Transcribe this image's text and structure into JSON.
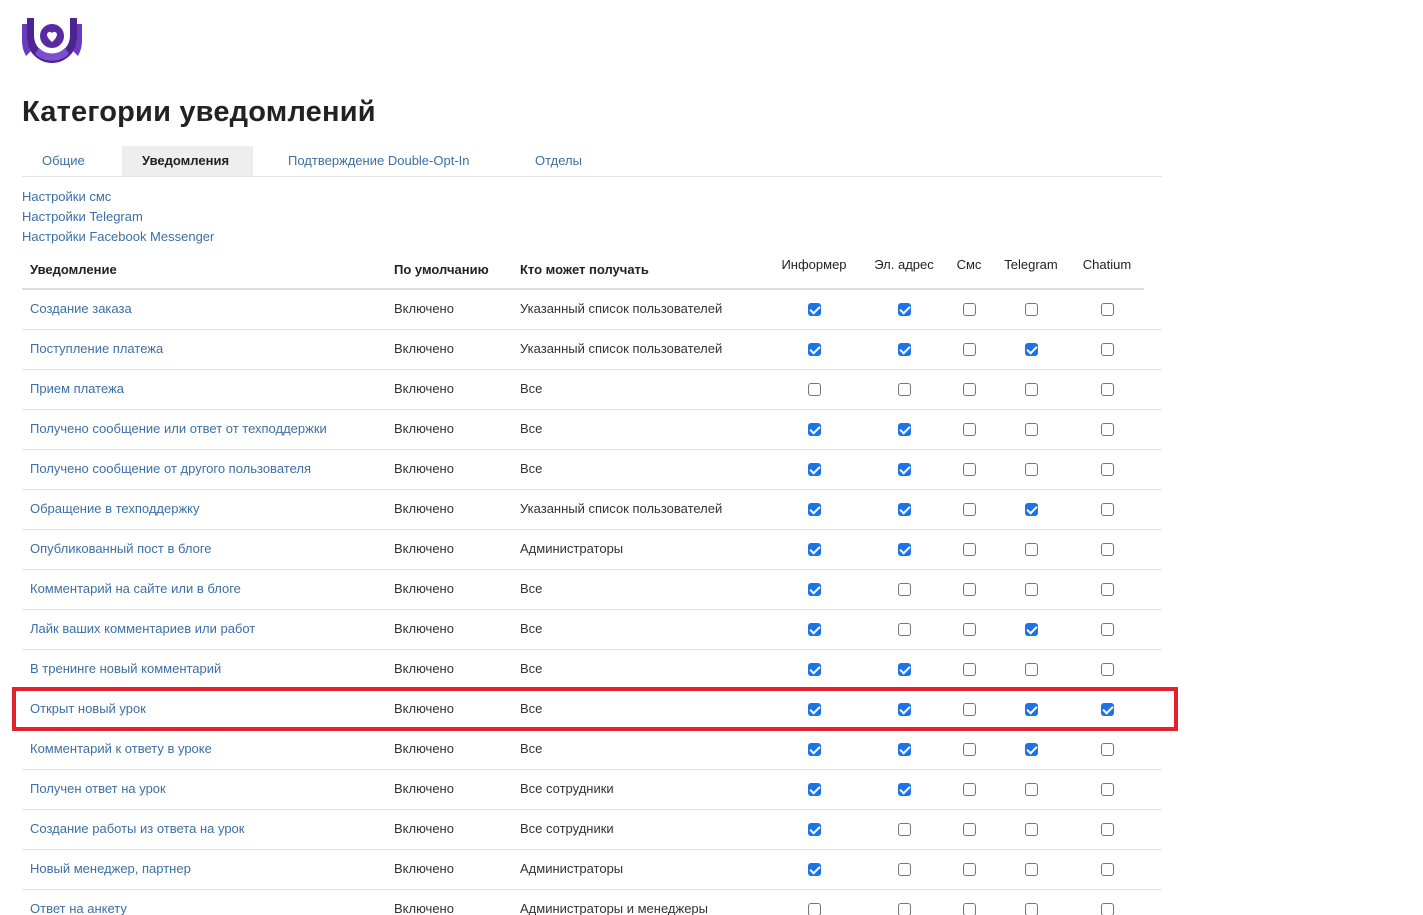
{
  "page": {
    "title": "Категории уведомлений"
  },
  "tabs": [
    {
      "label": "Общие",
      "active": false
    },
    {
      "label": "Уведомления",
      "active": true
    },
    {
      "label": "Подтверждение Double-Opt-In",
      "active": false
    },
    {
      "label": "Отделы",
      "active": false
    }
  ],
  "links": [
    "Настройки смс",
    "Настройки Telegram",
    "Настройки Facebook Messenger"
  ],
  "table": {
    "headers": {
      "notification": "Уведомление",
      "default": "По умолчанию",
      "who": "Кто может получать"
    },
    "channels": [
      "Информер",
      "Эл. адрес",
      "Смс",
      "Telegram",
      "Chatium"
    ],
    "rows": [
      {
        "name": "Создание заказа",
        "default": "Включено",
        "who": "Указанный список пользователей",
        "checks": [
          true,
          true,
          false,
          false,
          false
        ]
      },
      {
        "name": "Поступление платежа",
        "default": "Включено",
        "who": "Указанный список пользователей",
        "checks": [
          true,
          true,
          false,
          true,
          false
        ]
      },
      {
        "name": "Прием платежа",
        "default": "Включено",
        "who": "Все",
        "checks": [
          false,
          false,
          false,
          false,
          false
        ]
      },
      {
        "name": "Получено сообщение или ответ от техподдержки",
        "default": "Включено",
        "who": "Все",
        "checks": [
          true,
          true,
          false,
          false,
          false
        ]
      },
      {
        "name": "Получено сообщение от другого пользователя",
        "default": "Включено",
        "who": "Все",
        "checks": [
          true,
          true,
          false,
          false,
          false
        ]
      },
      {
        "name": "Обращение в техподдержку",
        "default": "Включено",
        "who": "Указанный список пользователей",
        "checks": [
          true,
          true,
          false,
          true,
          false
        ]
      },
      {
        "name": "Опубликованный пост в блоге",
        "default": "Включено",
        "who": "Администраторы",
        "checks": [
          true,
          true,
          false,
          false,
          false
        ]
      },
      {
        "name": "Комментарий на сайте или в блоге",
        "default": "Включено",
        "who": "Все",
        "checks": [
          true,
          false,
          false,
          false,
          false
        ]
      },
      {
        "name": "Лайк ваших комментариев или работ",
        "default": "Включено",
        "who": "Все",
        "checks": [
          true,
          false,
          false,
          true,
          false
        ]
      },
      {
        "name": "В тренинге новый комментарий",
        "default": "Включено",
        "who": "Все",
        "checks": [
          true,
          true,
          false,
          false,
          false
        ]
      },
      {
        "name": "Открыт новый урок",
        "default": "Включено",
        "who": "Все",
        "checks": [
          true,
          true,
          false,
          true,
          true
        ]
      },
      {
        "name": "Комментарий к ответу в уроке",
        "default": "Включено",
        "who": "Все",
        "checks": [
          true,
          true,
          false,
          true,
          false
        ]
      },
      {
        "name": "Получен ответ на урок",
        "default": "Включено",
        "who": "Все сотрудники",
        "checks": [
          true,
          true,
          false,
          false,
          false
        ]
      },
      {
        "name": "Создание работы из ответа на урок",
        "default": "Включено",
        "who": "Все сотрудники",
        "checks": [
          true,
          false,
          false,
          false,
          false
        ]
      },
      {
        "name": "Новый менеджер, партнер",
        "default": "Включено",
        "who": "Администраторы",
        "checks": [
          true,
          false,
          false,
          false,
          false
        ]
      },
      {
        "name": "Ответ на анкету",
        "default": "Включено",
        "who": "Администраторы и менеджеры",
        "checks": [
          false,
          false,
          false,
          false,
          false
        ]
      }
    ]
  },
  "highlighted_row_index": 10,
  "colors": {
    "link": "#3d6fa5",
    "highlight": "#e3232b",
    "checkbox_on": "#1a73e8",
    "logo_primary": "#5a2aa0",
    "logo_light": "#7b4fd0"
  },
  "icons": {
    "logo": "heart-shield-logo-icon"
  }
}
